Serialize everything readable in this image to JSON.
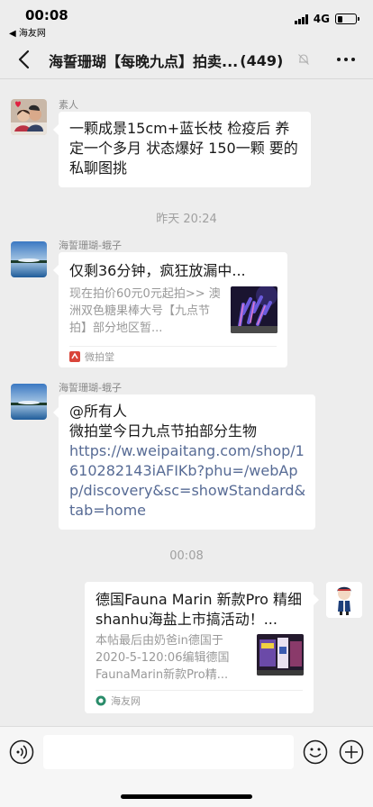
{
  "status_bar": {
    "time": "00:08",
    "back_app": "◀ 海友网",
    "network": "4G",
    "battery_level": 0.3
  },
  "nav": {
    "title": "海誓珊瑚【每晚九点】拍卖...",
    "count": "(449)"
  },
  "messages": {
    "m1": {
      "sender": "素人",
      "text": "一颗成景15cm+蓝长枝 检疫后 养定一个多月 状态爆好 150一颗 要的私聊图挑"
    },
    "time1": "昨天 20:24",
    "m2": {
      "sender": "海誓珊瑚-蛾子",
      "title": "仅剩36分钟，疯狂放漏中...",
      "desc": "现在拍价60元0元起拍>> 澳洲双色糖果棒大号【九点节拍】部分地区暂...",
      "source": "微拍堂"
    },
    "m3": {
      "sender": "海誓珊瑚-蛾子",
      "line1": "@所有人",
      "line2": "微拍堂今日九点节拍部分生物",
      "url": "https://w.weipaitang.com/shop/1610282143iAFIKb?phu=/webApp/discovery&sc=showStandard&tab=home"
    },
    "time2": "00:08",
    "m4": {
      "title": "德国Fauna Marin 新款Pro 精细shanhu海盐上市搞活动！...",
      "desc": "本帖最后由奶爸in德国于2020-5-120:06编辑德国FaunaMarin新款Pro精...",
      "source": "海友网"
    }
  },
  "icons": {
    "back": "chevron-left-icon",
    "mute": "bell-off-icon",
    "more": "more-dots-icon",
    "voice": "voice-icon",
    "emoji": "emoji-icon",
    "plus": "plus-icon"
  },
  "colors": {
    "background": "#ededed",
    "bubble": "#ffffff",
    "link": "#576b95",
    "meta_text": "#a0a0a0"
  }
}
